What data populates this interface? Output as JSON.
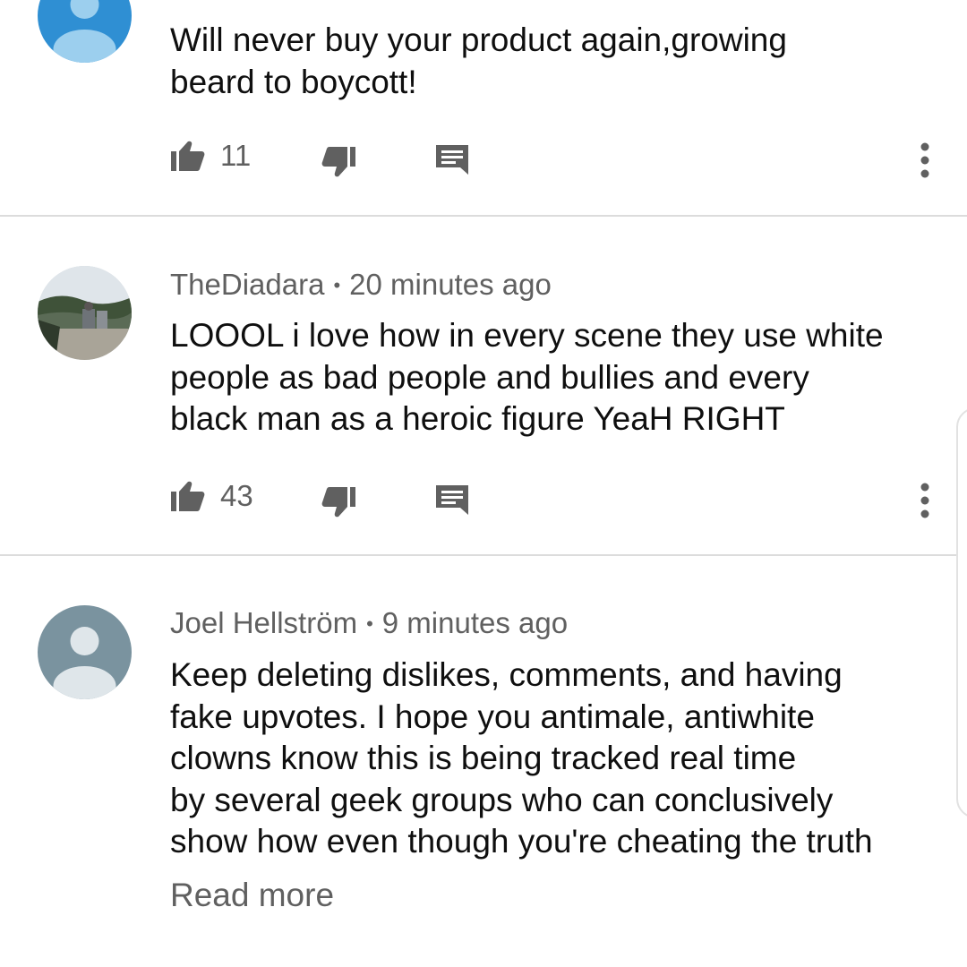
{
  "comments": [
    {
      "author": "",
      "time": "",
      "lines": [
        "Will never buy your product again,growing",
        "beard to boycott!"
      ],
      "likes": "11"
    },
    {
      "author": "TheDiadara",
      "separator": "•",
      "time": "20 minutes ago",
      "lines": [
        "LOOOL i love how in every scene they use white",
        "people as bad people and bullies and every",
        "black man as a heroic figure YeaH RIGHT"
      ],
      "likes": "43"
    },
    {
      "author": "Joel Hellström",
      "separator": "•",
      "time": "9 minutes ago",
      "lines": [
        "Keep deleting dislikes, comments, and having",
        "fake upvotes. I hope you antimale, antiwhite",
        "clowns know this is being tracked real time",
        "by several geek groups who can conclusively",
        "show how even though you're cheating the truth"
      ],
      "read_more": "Read more"
    }
  ],
  "icons": {
    "like": "thumbs-up-icon",
    "dislike": "thumbs-down-icon",
    "reply": "reply-comment-icon",
    "more": "more-vertical-icon"
  },
  "colors": {
    "text_primary": "#0f0f0f",
    "text_secondary": "#606060",
    "icon": "#606060",
    "divider": "#dcdcdc",
    "avatar_default_blue": "#9ccfee",
    "avatar_default_gray": "#7a939f"
  }
}
